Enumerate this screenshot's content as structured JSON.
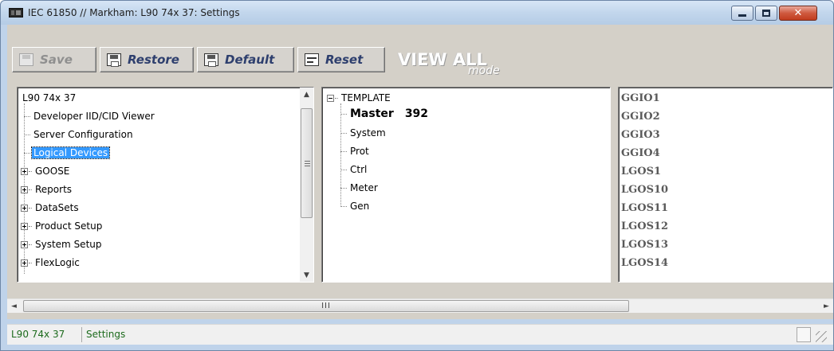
{
  "window": {
    "title": "IEC 61850 // Markham: L90 74x 37: Settings",
    "controls": {
      "minimize": "",
      "maximize": "",
      "close": "✕"
    }
  },
  "toolbar": {
    "save_label": "Save",
    "restore_label": "Restore",
    "default_label": "Default",
    "reset_label": "Reset",
    "view_all": "VIEW ALL",
    "mode": "mode"
  },
  "left_tree": {
    "root": "L90 74x 37",
    "items": [
      {
        "label": "Developer IID/CID Viewer",
        "expandable": false
      },
      {
        "label": "Server Configuration",
        "expandable": false
      },
      {
        "label": "Logical Devices",
        "expandable": false,
        "selected": true
      },
      {
        "label": "GOOSE",
        "expandable": true
      },
      {
        "label": "Reports",
        "expandable": true
      },
      {
        "label": "DataSets",
        "expandable": true
      },
      {
        "label": "Product Setup",
        "expandable": true
      },
      {
        "label": "System Setup",
        "expandable": true
      },
      {
        "label": "FlexLogic",
        "expandable": true
      }
    ]
  },
  "middle_tree": {
    "root": "TEMPLATE",
    "master_label": "Master",
    "master_count": "392",
    "items": [
      "System",
      "Prot",
      "Ctrl",
      "Meter",
      "Gen"
    ]
  },
  "right_list": {
    "items": [
      "GGIO1",
      "GGIO2",
      "GGIO3",
      "GGIO4",
      "LGOS1",
      "LGOS10",
      "LGOS11",
      "LGOS12",
      "LGOS13",
      "LGOS14"
    ]
  },
  "hscroll": {
    "grip": "III"
  },
  "status": {
    "device": "L90 74x 37",
    "view": "Settings"
  },
  "colors": {
    "selection": "#3399ff",
    "status_text": "#1c6a1c",
    "toolbar_text": "#2e3f6e"
  }
}
